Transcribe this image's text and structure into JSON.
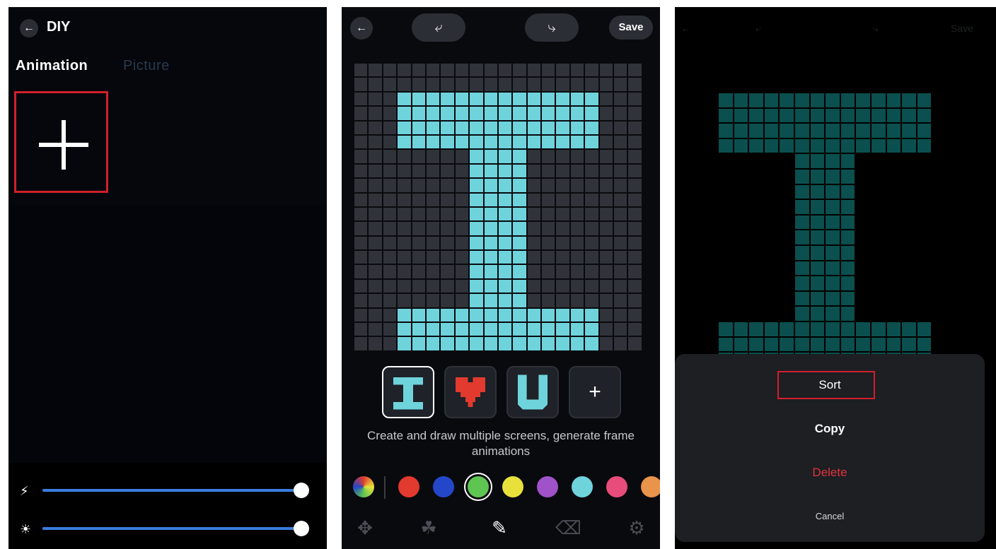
{
  "panel1": {
    "title": "DIY",
    "tabs": [
      "Animation",
      "Picture"
    ],
    "sliders": [
      {
        "icon": "lightning-icon",
        "value_fraction": 1.0
      },
      {
        "icon": "brightness-icon",
        "value_fraction": 1.0
      }
    ]
  },
  "panel2": {
    "save_label": "Save",
    "caption": "Create and draw multiple screens, generate frame animations",
    "frames": [
      "I",
      "heart",
      "U"
    ],
    "selected_color": "#5ec552",
    "palette_colors": [
      "#e23a2e",
      "#2447c9",
      "#5ec552",
      "#e8e13c",
      "#a052c9",
      "#6fd3dc",
      "#e84c7a",
      "#e8944a"
    ],
    "accent_color": "#6fd3dc",
    "tools": [
      "move-icon",
      "fill-icon",
      "pencil-icon",
      "eraser-icon",
      "gear-icon"
    ]
  },
  "panel3": {
    "sheet": {
      "sort_label": "Sort",
      "copy_label": "Copy",
      "delete_label": "Delete",
      "cancel_label": "Cancel"
    },
    "header_dim": {
      "back": "←",
      "save": "Save"
    }
  }
}
